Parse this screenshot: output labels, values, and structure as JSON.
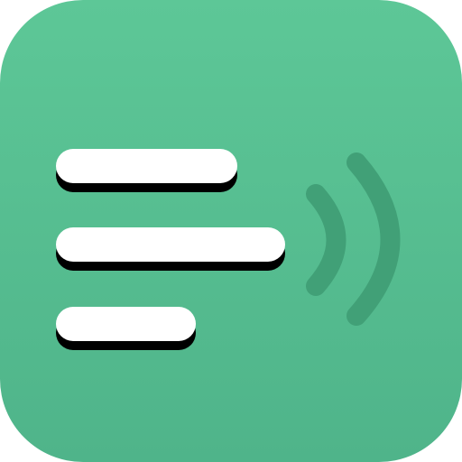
{
  "app_icon": {
    "icon_name": "text-to-speech-icon",
    "colors": {
      "background_top": "#5DC797",
      "background_bottom": "#4FB48A",
      "line_fill": "#FFFFFF",
      "line_shadow": "#000000",
      "wave": "#41A077"
    },
    "text_lines": [
      {
        "name": "text-line-top",
        "relative_length": 0.79
      },
      {
        "name": "text-line-middle",
        "relative_length": 1.0
      },
      {
        "name": "text-line-bottom",
        "relative_length": 0.61
      }
    ],
    "sound_waves": [
      {
        "name": "sound-wave-inner"
      },
      {
        "name": "sound-wave-outer"
      }
    ]
  }
}
